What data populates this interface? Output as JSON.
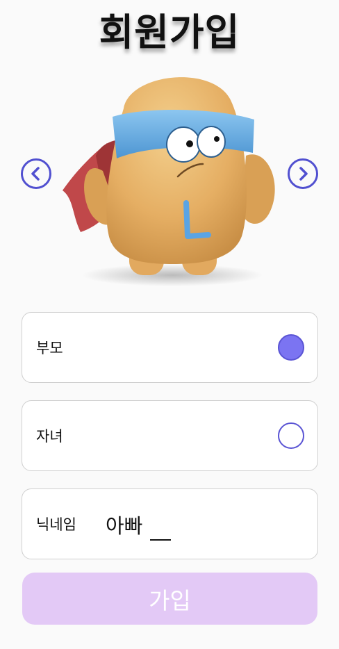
{
  "header": {
    "title": "회원가입"
  },
  "carousel": {
    "prev_icon": "chevron-left-circle-icon",
    "next_icon": "chevron-right-circle-icon",
    "character_name": "L"
  },
  "form": {
    "role_options": [
      {
        "label": "부모",
        "selected": true
      },
      {
        "label": "자녀",
        "selected": false
      }
    ],
    "nickname": {
      "label": "닉네임",
      "value": "아빠"
    },
    "submit_label": "가입"
  },
  "colors": {
    "accent": "#5150d0",
    "radio_fill": "#7b74f2",
    "submit_bg": "#e3c9f6",
    "band": "#6fb2e6",
    "body": "#e9b870",
    "cape": "#c0484a"
  }
}
